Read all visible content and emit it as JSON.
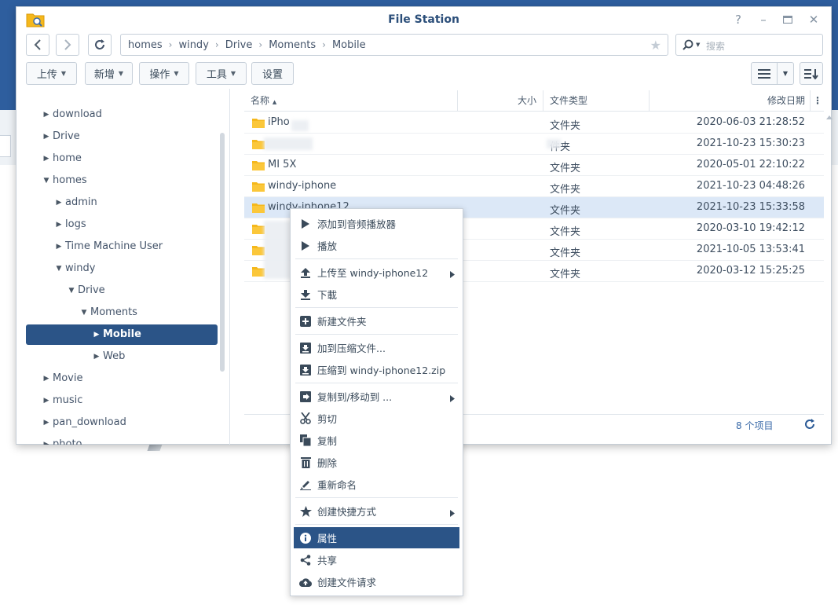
{
  "window": {
    "title": "File Station"
  },
  "nav": {
    "path": [
      "homes",
      "windy",
      "Drive",
      "Moments",
      "Mobile"
    ],
    "search_placeholder": "搜索"
  },
  "toolbar": {
    "upload": "上传",
    "create": "新增",
    "action": "操作",
    "tools": "工具",
    "settings": "设置"
  },
  "sidebar": {
    "items": [
      {
        "label": "download",
        "expanded": false
      },
      {
        "label": "Drive",
        "expanded": false
      },
      {
        "label": "home",
        "expanded": false
      },
      {
        "label": "homes",
        "expanded": true
      },
      {
        "label": "admin",
        "expanded": false
      },
      {
        "label": "logs",
        "expanded": false
      },
      {
        "label": "Time Machine User",
        "expanded": false
      },
      {
        "label": "windy",
        "expanded": true
      },
      {
        "label": "Drive",
        "expanded": true
      },
      {
        "label": "Moments",
        "expanded": true
      },
      {
        "label": "Mobile",
        "expanded": false,
        "selected": true
      },
      {
        "label": "Web",
        "expanded": false
      },
      {
        "label": "Movie",
        "expanded": false
      },
      {
        "label": "music",
        "expanded": false
      },
      {
        "label": "pan_download",
        "expanded": false
      },
      {
        "label": "photo",
        "expanded": false
      }
    ]
  },
  "file_list": {
    "columns": {
      "name": "名称",
      "size": "大小",
      "type": "文件类型",
      "modified": "修改日期"
    },
    "rows": [
      {
        "name": "iPho",
        "type": "文件夹",
        "modified": "2020-06-03 21:28:52"
      },
      {
        "name": "",
        "type": "件夹",
        "modified": "2021-10-23 15:30:23"
      },
      {
        "name": "MI 5X",
        "type": "文件夹",
        "modified": "2020-05-01 22:10:22"
      },
      {
        "name": "windy-iphone",
        "type": "文件夹",
        "modified": "2021-10-23 04:48:26"
      },
      {
        "name": "windy-iphone12",
        "type": "文件夹",
        "modified": "2021-10-23 15:33:58",
        "selected": true
      },
      {
        "name": "",
        "type": "文件夹",
        "modified": "2020-03-10 19:42:12"
      },
      {
        "name": "",
        "type": "文件夹",
        "modified": "2021-10-05 13:53:41"
      },
      {
        "name": "",
        "type": "文件夹",
        "modified": "2020-03-12 15:25:25"
      }
    ],
    "item_count": "8 个项目"
  },
  "context_menu": {
    "add_to_player": "添加到音频播放器",
    "play": "播放",
    "upload_to": "上传至 windy-iphone12",
    "download": "下載",
    "new_folder": "新建文件夹",
    "add_to_archive": "加到压缩文件...",
    "compress_to": "压缩到 windy-iphone12.zip",
    "copy_move_to": "复制到/移动到 ...",
    "cut": "剪切",
    "copy": "复制",
    "delete": "删除",
    "rename": "重新命名",
    "create_shortcut": "创建快捷方式",
    "properties": "属性",
    "share": "共享",
    "create_file_request": "创建文件请求"
  },
  "colors": {
    "accent": "#2b5487",
    "folder": "#f5b81c",
    "selected_row": "#dce8f7"
  }
}
